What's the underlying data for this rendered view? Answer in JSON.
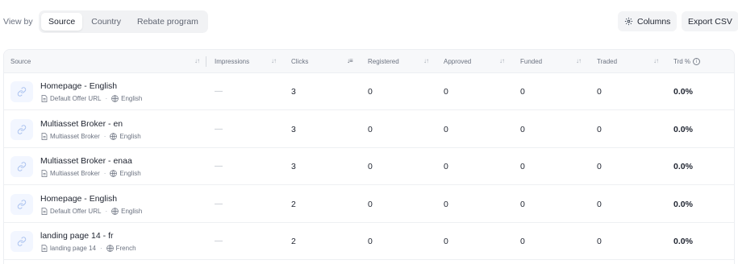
{
  "toolbar": {
    "view_by_label": "View by",
    "tabs": [
      {
        "label": "Source",
        "active": true
      },
      {
        "label": "Country",
        "active": false
      },
      {
        "label": "Rebate program",
        "active": false
      }
    ],
    "columns_label": "Columns",
    "export_label": "Export CSV"
  },
  "table": {
    "columns": [
      "Source",
      "Impressions",
      "Clicks",
      "Registered",
      "Approved",
      "Funded",
      "Traded",
      "Trd %"
    ],
    "rows": [
      {
        "title": "Homepage - English",
        "meta_type": "Default Offer URL",
        "meta_lang": "English",
        "impressions": "—",
        "clicks": "3",
        "registered": "0",
        "approved": "0",
        "funded": "0",
        "traded": "0",
        "trd": "0.0%"
      },
      {
        "title": "Multiasset Broker - en",
        "meta_type": "Multiasset Broker",
        "meta_lang": "English",
        "impressions": "—",
        "clicks": "3",
        "registered": "0",
        "approved": "0",
        "funded": "0",
        "traded": "0",
        "trd": "0.0%"
      },
      {
        "title": "Multiasset Broker - enaa",
        "meta_type": "Multiasset Broker",
        "meta_lang": "English",
        "impressions": "—",
        "clicks": "3",
        "registered": "0",
        "approved": "0",
        "funded": "0",
        "traded": "0",
        "trd": "0.0%"
      },
      {
        "title": "Homepage - English",
        "meta_type": "Default Offer URL",
        "meta_lang": "English",
        "impressions": "—",
        "clicks": "2",
        "registered": "0",
        "approved": "0",
        "funded": "0",
        "traded": "0",
        "trd": "0.0%"
      },
      {
        "title": "landing page 14 - fr",
        "meta_type": "landing page 14",
        "meta_lang": "French",
        "impressions": "—",
        "clicks": "2",
        "registered": "0",
        "approved": "0",
        "funded": "0",
        "traded": "0",
        "trd": "0.0%"
      }
    ]
  },
  "icons": {
    "source": "link-icon",
    "meta_type": "document-icon",
    "meta_lang": "globe-icon",
    "columns": "gear-icon",
    "info": "info-icon",
    "sort": "sort-arrows-icon"
  },
  "colors": {
    "accent_icon": "#a9c1ef",
    "tab_bg": "#f1f2f4",
    "header_bg": "#f7f8fa"
  }
}
